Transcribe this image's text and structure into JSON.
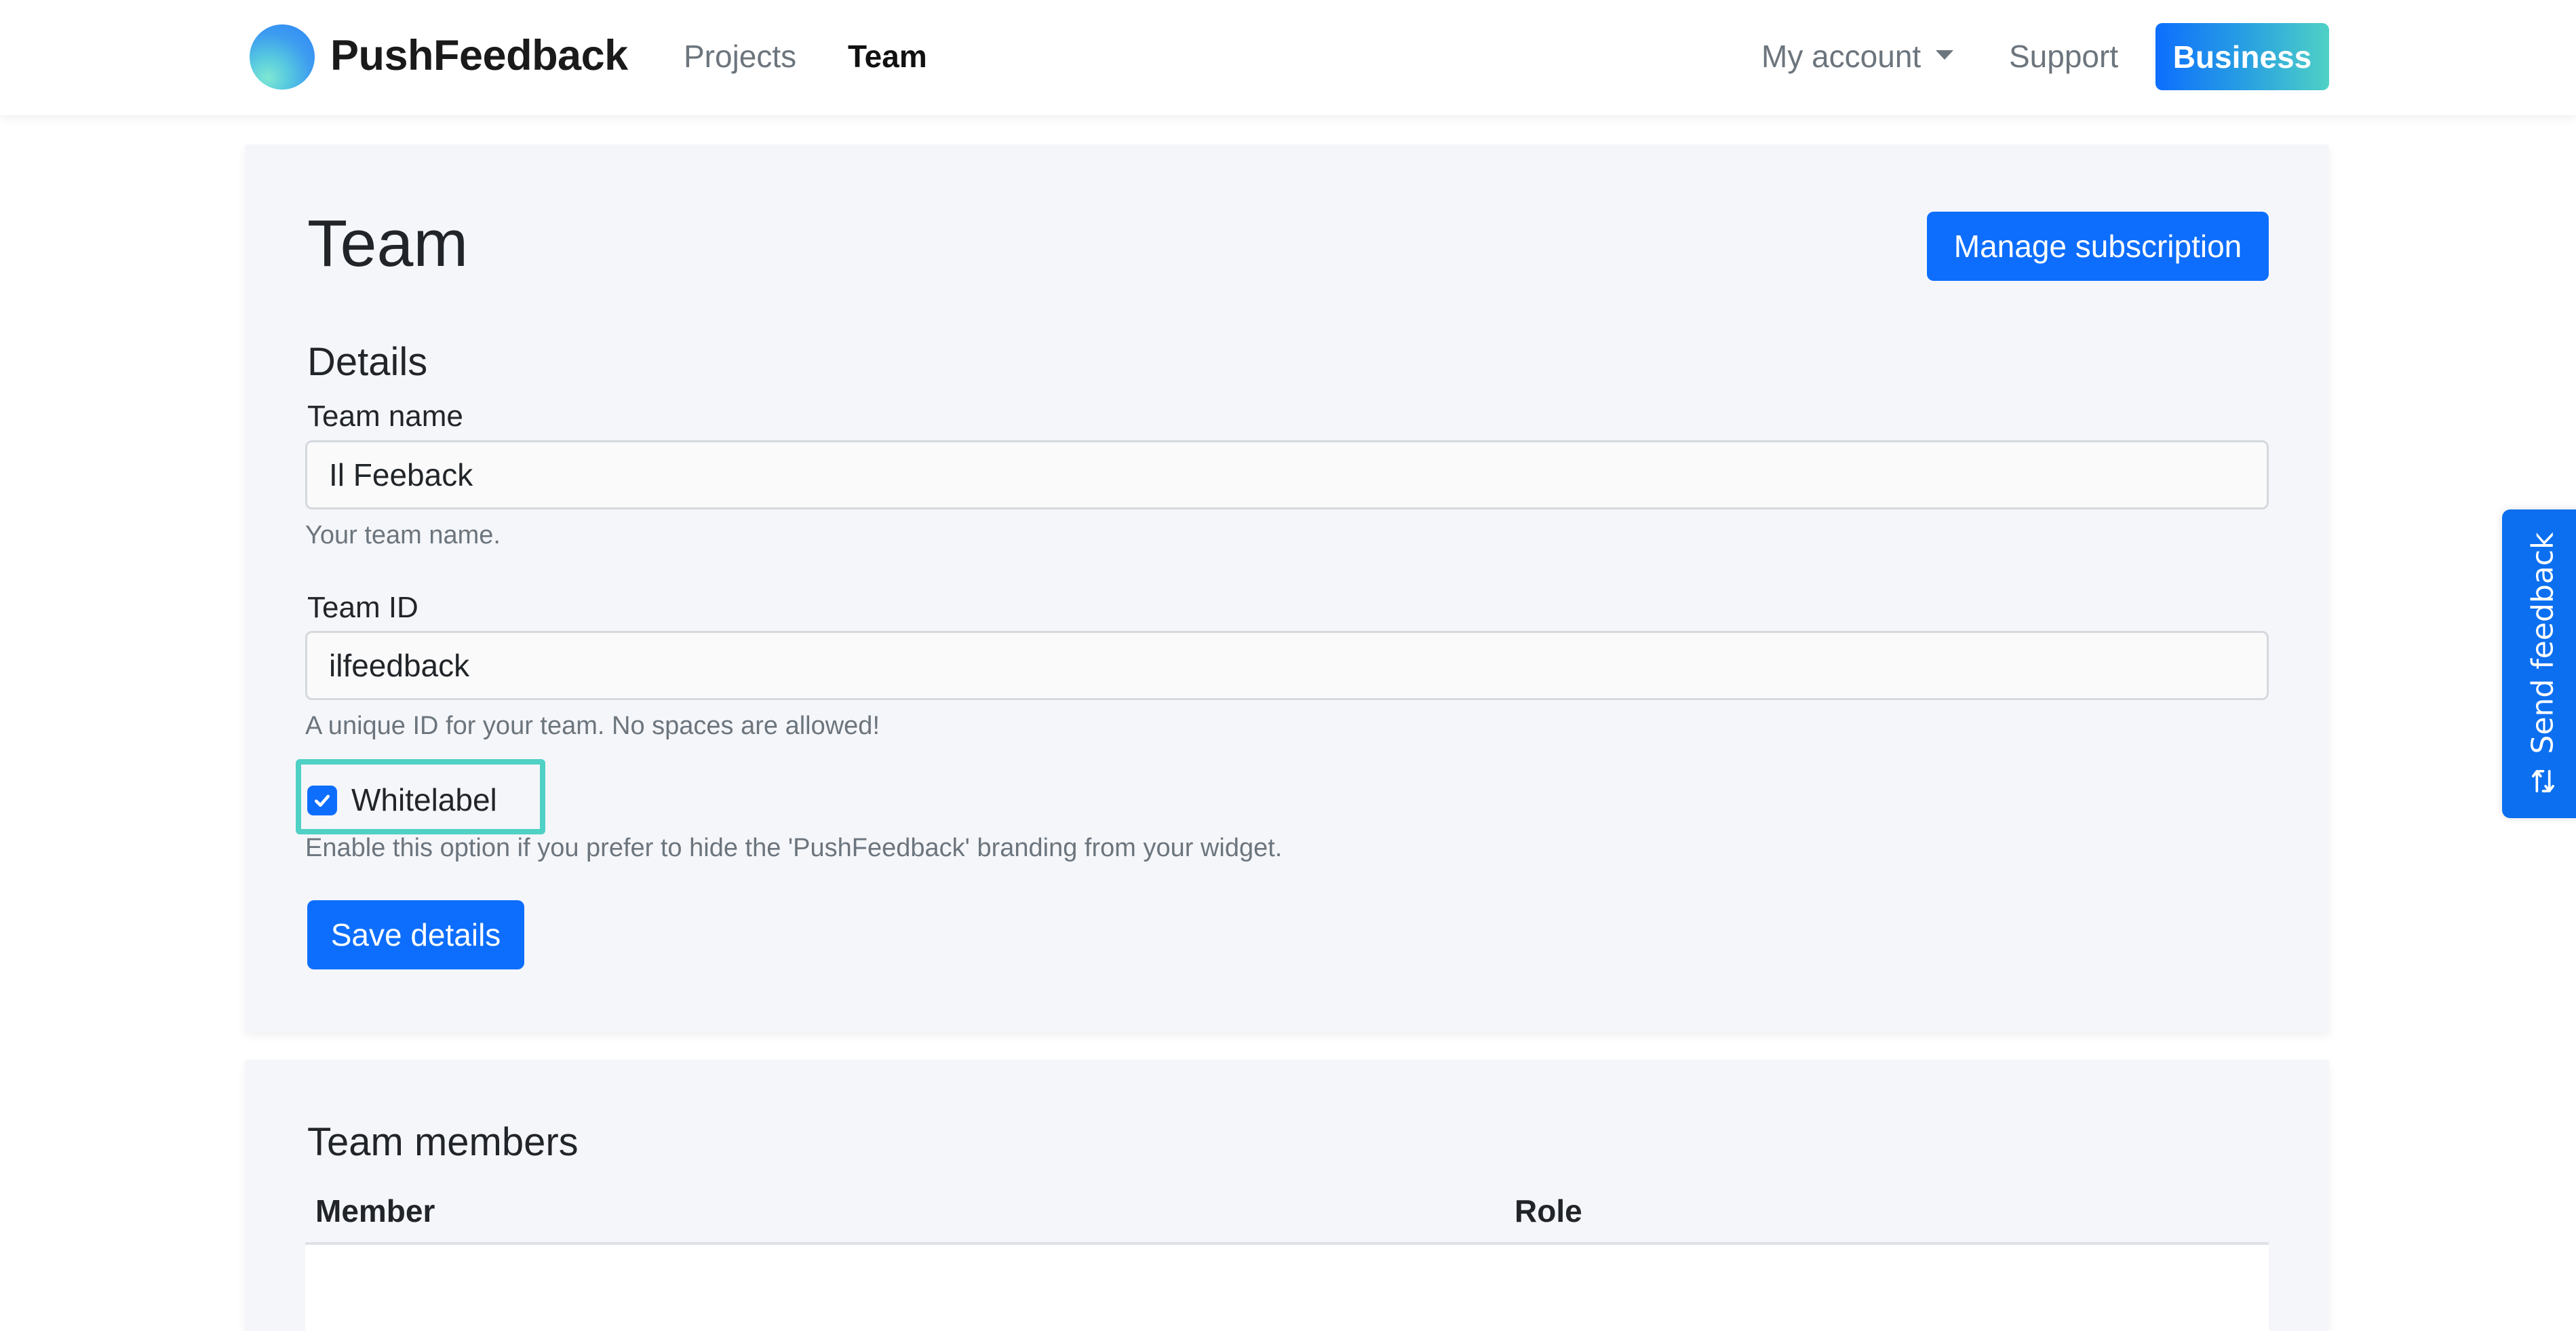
{
  "navbar": {
    "brand": "PushFeedback",
    "links": [
      {
        "label": "Projects",
        "active": false
      },
      {
        "label": "Team",
        "active": true
      }
    ],
    "account_label": "My account",
    "support_label": "Support",
    "plan_button": "Business"
  },
  "page": {
    "title": "Team",
    "manage_subscription_label": "Manage subscription"
  },
  "details": {
    "heading": "Details",
    "team_name": {
      "label": "Team name",
      "value": "Il Feeback",
      "help": "Your team name."
    },
    "team_id": {
      "label": "Team ID",
      "value": "ilfeedback",
      "help": "A unique ID for your team. No spaces are allowed!"
    },
    "whitelabel": {
      "label": "Whitelabel",
      "checked": true,
      "help": "Enable this option if you prefer to hide the 'PushFeedback' branding from your widget."
    },
    "save_label": "Save details"
  },
  "members": {
    "heading": "Team members",
    "columns": [
      "Member",
      "Role"
    ]
  },
  "feedback_tab": {
    "label": "Send feedback",
    "icon": "repeat-arrows-icon"
  },
  "colors": {
    "primary": "#0d6efd",
    "highlight": "#4fd1c5",
    "card_bg": "#f5f6fa",
    "muted_text": "#6c757d"
  }
}
